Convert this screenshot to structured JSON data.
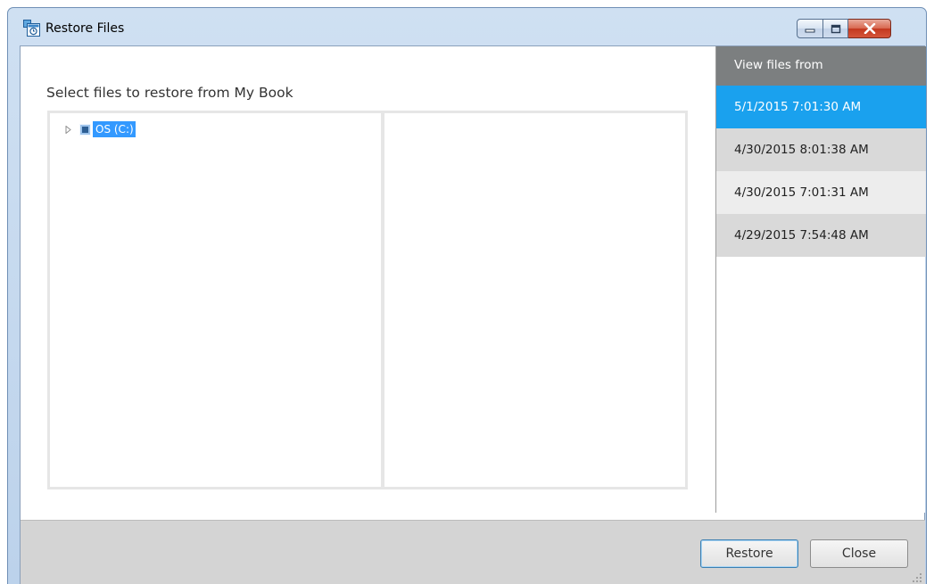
{
  "window": {
    "title": "Restore Files"
  },
  "main": {
    "heading": "Select files to restore from My Book",
    "tree": {
      "items": [
        {
          "label": "OS (C:)"
        }
      ]
    }
  },
  "sidebar": {
    "header": "View files from",
    "dates": [
      {
        "label": "5/1/2015 7:01:30 AM",
        "selected": true
      },
      {
        "label": "4/30/2015 8:01:38 AM",
        "selected": false
      },
      {
        "label": "4/30/2015 7:01:31 AM",
        "selected": false
      },
      {
        "label": "4/29/2015 7:54:48 AM",
        "selected": false
      }
    ]
  },
  "footer": {
    "restore_label": "Restore",
    "close_label": "Close"
  },
  "icons": {
    "app": "restore-files-icon",
    "minimize": "minimize-icon",
    "maximize": "maximize-icon",
    "close": "close-icon",
    "expander": "triangle-right-icon",
    "drive": "drive-checkbox-icon",
    "grip": "resize-grip-icon"
  },
  "colors": {
    "selection": "#1aa1ee",
    "sidebar_header": "#7c7f80",
    "tree_selection": "#3399ff"
  }
}
